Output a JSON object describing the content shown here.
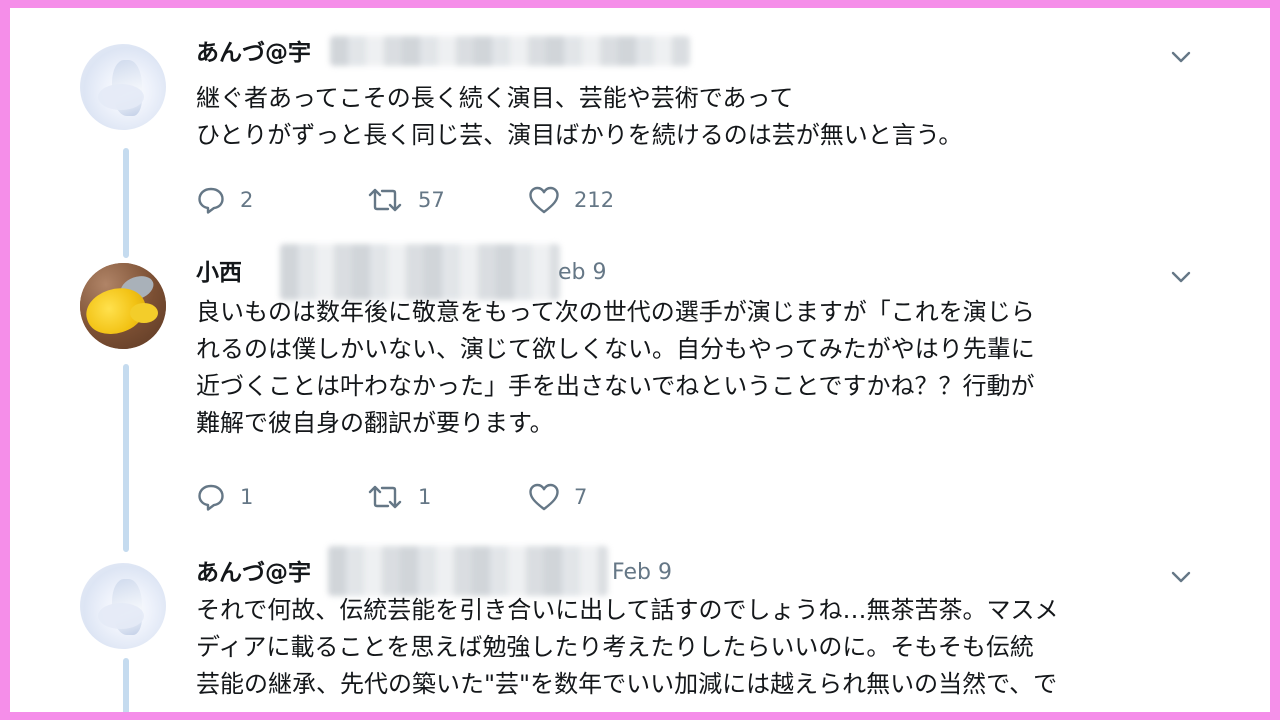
{
  "colors": {
    "border": "#f58ee9",
    "background": "#ffffff",
    "thread_line": "#c5dbef",
    "meta_text": "#657786"
  },
  "tweets": [
    {
      "name": "あんづ@宇",
      "date": "",
      "lines": [
        "継ぐ者あってこその長く続く演目、芸能や芸術であって",
        "ひとりがずっと長く同じ芸、演目ばかりを続けるのは芸が無いと言う。"
      ],
      "replies": "2",
      "retweets": "57",
      "likes": "212",
      "icons": [
        "reply-icon",
        "retweet-icon",
        "like-icon",
        "chevron-down-icon"
      ]
    },
    {
      "name": "小西",
      "date": "eb 9",
      "lines": [
        "良いものは数年後に敬意をもって次の世代の選手が演じますが「これを演じら",
        "れるのは僕しかいない、演じて欲しくない。自分もやってみたがやはり先輩に",
        "近づくことは叶わなかった」手を出さないでねということですかね？？行動が",
        "難解で彼自身の翻訳が要ります。"
      ],
      "replies": "1",
      "retweets": "1",
      "likes": "7",
      "icons": [
        "reply-icon",
        "retweet-icon",
        "like-icon",
        "chevron-down-icon"
      ]
    },
    {
      "name": "あんづ@宇",
      "date": "Feb 9",
      "lines": [
        "それで何故、伝統芸能を引き合いに出して話すのでしょうね…無茶苦茶。マスメ",
        "ディアに載ることを思えば勉強したり考えたりしたらいいのに。そもそも伝統",
        "芸能の継承、先代の築いた\"芸\"を数年でいい加減には越えられ無いの当然で、で"
      ],
      "icons": [
        "chevron-down-icon"
      ]
    }
  ]
}
